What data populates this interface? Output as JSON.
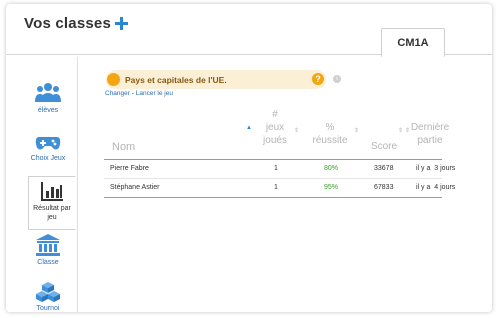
{
  "header": {
    "title": "Vos classes"
  },
  "tabs": [
    {
      "label": "CM1A"
    }
  ],
  "sidebar": {
    "items": [
      {
        "label": "élèves",
        "icon": "users-icon"
      },
      {
        "label": "Choix Jeux",
        "icon": "gamepad-icon"
      },
      {
        "label": "Résultat par jeu",
        "icon": "bar-chart-icon"
      },
      {
        "label": "Classe",
        "icon": "school-building-icon"
      },
      {
        "label": "Tournoi",
        "icon": "cubes-icon"
      }
    ]
  },
  "game": {
    "title": "Pays et capitales de l'UE.",
    "help": "?",
    "info": "i",
    "change_link": "Changer",
    "separator": "-",
    "launch_link": "Lancer le jeu"
  },
  "table": {
    "headers": {
      "name": "Nom",
      "games_line1": "#",
      "games_line2": "jeux",
      "games_line3": "joués",
      "success_line1": "%",
      "success_line2": "réussite",
      "score": "Score",
      "last_line1": "Dernière",
      "last_line2": "partie"
    },
    "rows": [
      {
        "name": "Pierre Fabre",
        "games": "1",
        "success": "80%",
        "score": "33678",
        "last": "il y a  3 jours"
      },
      {
        "name": "Stéphane Astier",
        "games": "1",
        "success": "95%",
        "score": "67833",
        "last": "il y a  4 jours"
      }
    ]
  },
  "colors": {
    "accent": "#2b86d0",
    "coin": "#f3a612",
    "game_bar": "#fbefd6",
    "success": "#3aa02a"
  }
}
